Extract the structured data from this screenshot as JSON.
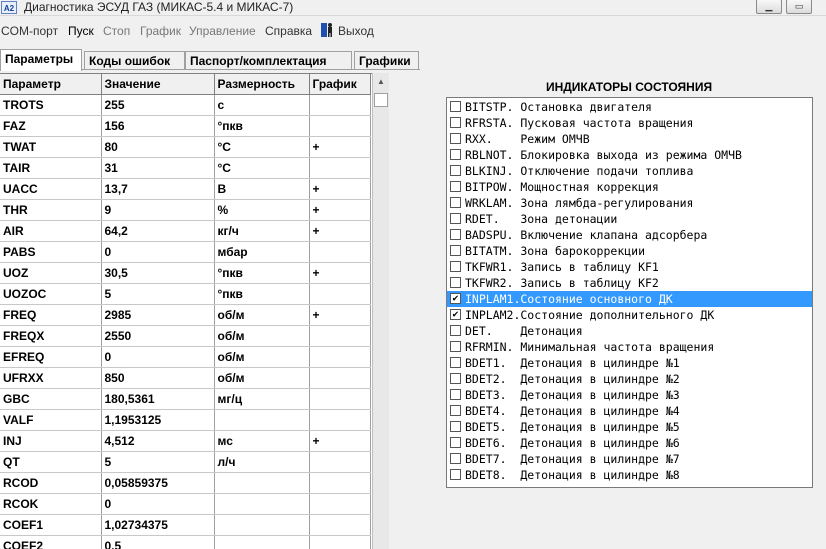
{
  "window": {
    "title": "Диагностика ЭСУД ГАЗ (МИКАС-5.4 и МИКАС-7)",
    "app_icon": "A2"
  },
  "menu": [
    "COM-порт",
    "Пуск",
    "Стоп",
    "График",
    "Управление",
    "Справка",
    "Выход"
  ],
  "tabs": [
    "Параметры",
    "Коды ошибок",
    "Паспорт/комплектация",
    "Графики"
  ],
  "table": {
    "headers": [
      "Параметр",
      "Значение",
      "Размерность",
      "График"
    ],
    "rows": [
      {
        "name": "TROTS",
        "value": "255",
        "unit": "c",
        "graph": ""
      },
      {
        "name": "FAZ",
        "value": "156",
        "unit": "°пкв",
        "graph": ""
      },
      {
        "name": "TWAT",
        "value": "80",
        "unit": "°C",
        "graph": "+"
      },
      {
        "name": "TAIR",
        "value": "31",
        "unit": "°C",
        "graph": ""
      },
      {
        "name": "UACC",
        "value": "13,7",
        "unit": "В",
        "graph": "+"
      },
      {
        "name": "THR",
        "value": "9",
        "unit": "%",
        "graph": "+"
      },
      {
        "name": "AIR",
        "value": "64,2",
        "unit": "кг/ч",
        "graph": "+"
      },
      {
        "name": "PABS",
        "value": "0",
        "unit": "мбар",
        "graph": ""
      },
      {
        "name": "UOZ",
        "value": "30,5",
        "unit": "°пкв",
        "graph": "+"
      },
      {
        "name": "UOZOC",
        "value": "5",
        "unit": "°пкв",
        "graph": ""
      },
      {
        "name": "FREQ",
        "value": "2985",
        "unit": "об/м",
        "graph": "+"
      },
      {
        "name": "FREQX",
        "value": "2550",
        "unit": "об/м",
        "graph": ""
      },
      {
        "name": "EFREQ",
        "value": "0",
        "unit": "об/м",
        "graph": ""
      },
      {
        "name": "UFRXX",
        "value": "850",
        "unit": "об/м",
        "graph": ""
      },
      {
        "name": "GBC",
        "value": "180,5361",
        "unit": "мг/ц",
        "graph": ""
      },
      {
        "name": "VALF",
        "value": "1,1953125",
        "unit": "",
        "graph": ""
      },
      {
        "name": "INJ",
        "value": "4,512",
        "unit": "мс",
        "graph": "+"
      },
      {
        "name": "QT",
        "value": "5",
        "unit": "л/ч",
        "graph": ""
      },
      {
        "name": "RCOD",
        "value": "0,05859375",
        "unit": "",
        "graph": ""
      },
      {
        "name": "RCOK",
        "value": "0",
        "unit": "",
        "graph": ""
      },
      {
        "name": "COEF1",
        "value": "1,02734375",
        "unit": "",
        "graph": ""
      },
      {
        "name": "COEF2",
        "value": "0,5",
        "unit": "",
        "graph": ""
      }
    ]
  },
  "indicators": {
    "title": "ИНДИКАТОРЫ СОСТОЯНИЯ",
    "items": [
      {
        "text": "BITSTP. Остановка двигателя",
        "checked": false,
        "selected": false
      },
      {
        "text": "RFRSTA. Пусковая частота вращения",
        "checked": false,
        "selected": false
      },
      {
        "text": "RXX.    Режим ОМЧВ",
        "checked": false,
        "selected": false
      },
      {
        "text": "RBLNOT. Блокировка выхода из режима ОМЧВ",
        "checked": false,
        "selected": false
      },
      {
        "text": "BLKINJ. Отключение подачи топлива",
        "checked": false,
        "selected": false
      },
      {
        "text": "BITPOW. Мощностная коррекция",
        "checked": false,
        "selected": false
      },
      {
        "text": "WRKLAM. Зона лямбда-регулирования",
        "checked": false,
        "selected": false
      },
      {
        "text": "RDET.   Зона детонации",
        "checked": false,
        "selected": false
      },
      {
        "text": "BADSPU. Включение клапана адсорбера",
        "checked": false,
        "selected": false
      },
      {
        "text": "BITATM. Зона барокоррекции",
        "checked": false,
        "selected": false
      },
      {
        "text": "TKFWR1. Запись в таблицу KF1",
        "checked": false,
        "selected": false
      },
      {
        "text": "TKFWR2. Запись в таблицу KF2",
        "checked": false,
        "selected": false
      },
      {
        "text": "INPLAM1.Состояние основного ДК",
        "checked": true,
        "selected": true
      },
      {
        "text": "INPLAM2.Состояние дополнительного ДК",
        "checked": true,
        "selected": false
      },
      {
        "text": "DET.    Детонация",
        "checked": false,
        "selected": false
      },
      {
        "text": "RFRMIN. Минимальная частота вращения",
        "checked": false,
        "selected": false
      },
      {
        "text": "BDET1.  Детонация в цилиндре №1",
        "checked": false,
        "selected": false
      },
      {
        "text": "BDET2.  Детонация в цилиндре №2",
        "checked": false,
        "selected": false
      },
      {
        "text": "BDET3.  Детонация в цилиндре №3",
        "checked": false,
        "selected": false
      },
      {
        "text": "BDET4.  Детонация в цилиндре №4",
        "checked": false,
        "selected": false
      },
      {
        "text": "BDET5.  Детонация в цилиндре №5",
        "checked": false,
        "selected": false
      },
      {
        "text": "BDET6.  Детонация в цилиндре №6",
        "checked": false,
        "selected": false
      },
      {
        "text": "BDET7.  Детонация в цилиндре №7",
        "checked": false,
        "selected": false
      },
      {
        "text": "BDET8.  Детонация в цилиндре №8",
        "checked": false,
        "selected": false
      }
    ]
  },
  "icons": {
    "minimize": "minimize-icon",
    "maximize": "maximize-icon",
    "exit": "exit-person-icon",
    "check": "checkmark-icon"
  },
  "colors": {
    "selection": "#3399ff",
    "background": "#f0f0f0"
  }
}
